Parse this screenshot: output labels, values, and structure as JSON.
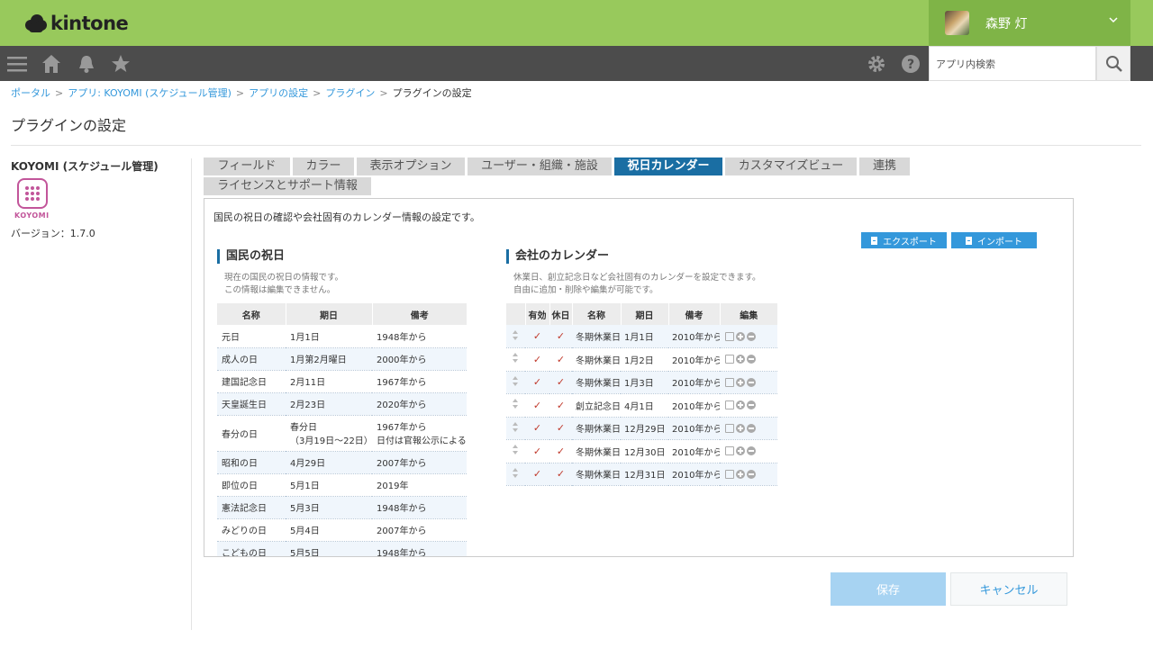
{
  "header": {
    "logo": "kintone",
    "user_name": "森野 灯"
  },
  "navbar": {
    "search_placeholder": "アプリ内検索"
  },
  "breadcrumb": {
    "portal": "ポータル",
    "app": "アプリ: KOYOMI (スケジュール管理)",
    "app_settings": "アプリの設定",
    "plugins": "プラグイン",
    "current": "プラグインの設定"
  },
  "page_title": "プラグインの設定",
  "plugin": {
    "name": "KOYOMI (スケジュール管理)",
    "icon_label": "KOYOMI",
    "version": "バージョン：1.7.0"
  },
  "tabs": [
    {
      "label": "フィールド"
    },
    {
      "label": "カラー"
    },
    {
      "label": "表示オプション"
    },
    {
      "label": "ユーザー・組織・施設"
    },
    {
      "label": "祝日カレンダー"
    },
    {
      "label": "カスタマイズビュー"
    },
    {
      "label": "連携"
    },
    {
      "label": "ライセンスとサポート情報"
    }
  ],
  "panel": {
    "description": "国民の祝日の確認や会社固有のカレンダー情報の設定です。",
    "export_label": "エクスポート",
    "import_label": "インポート"
  },
  "national": {
    "title": "国民の祝日",
    "desc1": "現在の国民の祝日の情報です。",
    "desc2": "この情報は編集できません。",
    "headers": [
      "名称",
      "期日",
      "備考"
    ],
    "rows": [
      [
        "元日",
        "1月1日",
        "1948年から"
      ],
      [
        "成人の日",
        "1月第2月曜日",
        "2000年から"
      ],
      [
        "建国記念日",
        "2月11日",
        "1967年から"
      ],
      [
        "天皇誕生日",
        "2月23日",
        "2020年から"
      ],
      [
        "春分の日",
        "春分日",
        "1967年から"
      ],
      [
        "昭和の日",
        "4月29日",
        "2007年から"
      ],
      [
        "即位の日",
        "5月1日",
        "2019年"
      ],
      [
        "憲法記念日",
        "5月3日",
        "1948年から"
      ],
      [
        "みどりの日",
        "5月4日",
        "2007年から"
      ],
      [
        "こどもの日",
        "5月5日",
        "1948年から"
      ]
    ],
    "shunbun_sub_date": "（3月19日～22日）",
    "shunbun_sub_note": "日付は官報公示による"
  },
  "company": {
    "title": "会社のカレンダー",
    "desc1": "休業日、創立記念日など会社固有のカレンダーを設定できます。",
    "desc2": "自由に追加・削除や編集が可能です。",
    "headers": [
      "",
      "有効",
      "休日",
      "名称",
      "期日",
      "備考",
      "編集"
    ],
    "rows": [
      [
        "冬期休業日",
        "1月1日",
        "2010年から"
      ],
      [
        "冬期休業日",
        "1月2日",
        "2010年から"
      ],
      [
        "冬期休業日",
        "1月3日",
        "2010年から"
      ],
      [
        "創立記念日",
        "4月1日",
        "2010年から"
      ],
      [
        "冬期休業日",
        "12月29日",
        "2010年から"
      ],
      [
        "冬期休業日",
        "12月30日",
        "2010年から"
      ],
      [
        "冬期休業日",
        "12月31日",
        "2010年から"
      ]
    ],
    "check_mark": "✓"
  },
  "footer": {
    "save_label": "保存",
    "cancel_label": "キャンセル"
  },
  "colors": {
    "header": "#98c95c",
    "navbar": "#4c4c4c",
    "accent": "#1a6ea3",
    "button": "#3498db"
  }
}
